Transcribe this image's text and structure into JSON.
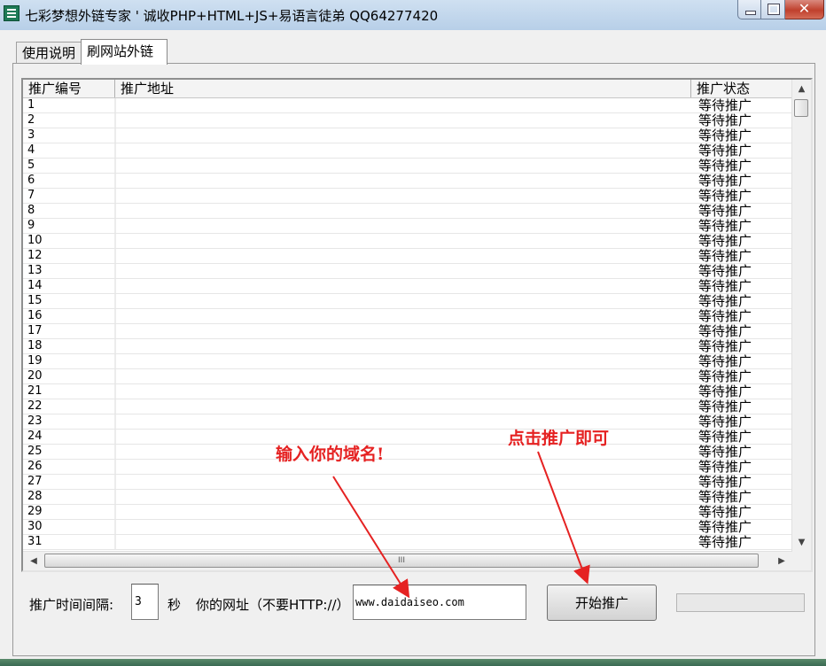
{
  "window": {
    "title": "七彩梦想外链专家 ' 诚收PHP+HTML+JS+易语言徒弟 QQ64277420",
    "close_glyph": "✕"
  },
  "tabs": [
    {
      "label": "使用说明",
      "active": false
    },
    {
      "label": "刷网站外链",
      "active": true
    }
  ],
  "table": {
    "columns": [
      "推广编号",
      "推广地址",
      "推广状态"
    ],
    "rows": [
      {
        "id": "1",
        "url": "",
        "status": "等待推广"
      },
      {
        "id": "2",
        "url": "",
        "status": "等待推广"
      },
      {
        "id": "3",
        "url": "",
        "status": "等待推广"
      },
      {
        "id": "4",
        "url": "",
        "status": "等待推广"
      },
      {
        "id": "5",
        "url": "",
        "status": "等待推广"
      },
      {
        "id": "6",
        "url": "",
        "status": "等待推广"
      },
      {
        "id": "7",
        "url": "",
        "status": "等待推广"
      },
      {
        "id": "8",
        "url": "",
        "status": "等待推广"
      },
      {
        "id": "9",
        "url": "",
        "status": "等待推广"
      },
      {
        "id": "10",
        "url": "",
        "status": "等待推广"
      },
      {
        "id": "12",
        "url": "",
        "status": "等待推广"
      },
      {
        "id": "13",
        "url": "",
        "status": "等待推广"
      },
      {
        "id": "14",
        "url": "",
        "status": "等待推广"
      },
      {
        "id": "15",
        "url": "",
        "status": "等待推广"
      },
      {
        "id": "16",
        "url": "",
        "status": "等待推广"
      },
      {
        "id": "17",
        "url": "",
        "status": "等待推广"
      },
      {
        "id": "18",
        "url": "",
        "status": "等待推广"
      },
      {
        "id": "19",
        "url": "",
        "status": "等待推广"
      },
      {
        "id": "20",
        "url": "",
        "status": "等待推广"
      },
      {
        "id": "21",
        "url": "",
        "status": "等待推广"
      },
      {
        "id": "22",
        "url": "",
        "status": "等待推广"
      },
      {
        "id": "23",
        "url": "",
        "status": "等待推广"
      },
      {
        "id": "24",
        "url": "",
        "status": "等待推广"
      },
      {
        "id": "25",
        "url": "",
        "status": "等待推广"
      },
      {
        "id": "26",
        "url": "",
        "status": "等待推广"
      },
      {
        "id": "27",
        "url": "",
        "status": "等待推广"
      },
      {
        "id": "28",
        "url": "",
        "status": "等待推广"
      },
      {
        "id": "29",
        "url": "",
        "status": "等待推广"
      },
      {
        "id": "30",
        "url": "",
        "status": "等待推广"
      },
      {
        "id": "31",
        "url": "",
        "status": "等待推广"
      }
    ],
    "hscroll_grip": "III"
  },
  "controls": {
    "interval_label": "推广时间间隔:",
    "interval_value": "3",
    "seconds_label": "秒",
    "url_label": "你的网址（不要HTTP://）",
    "url_value": "www.daidaiseo.com",
    "start_button": "开始推广",
    "progress": 0
  },
  "annotations": {
    "enter_domain": "输入你的域名!",
    "click_start": "点击推广即可",
    "color": "#e52222"
  }
}
